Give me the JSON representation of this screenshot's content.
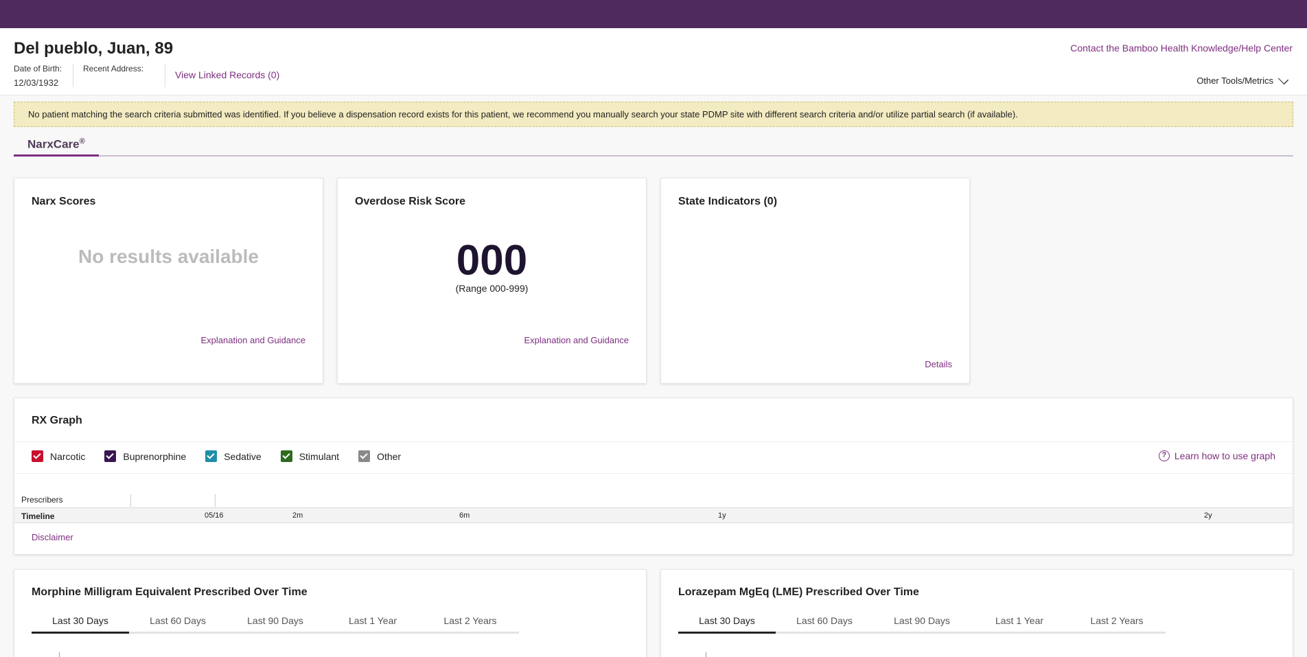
{
  "header": {
    "patient_name": "Del pueblo, Juan, 89",
    "dob_label": "Date of Birth:",
    "dob_value": "12/03/1932",
    "address_label": "Recent Address:",
    "address_value": "",
    "linked_records": "View Linked Records (0)",
    "help_link": "Contact the Bamboo Health Knowledge/Help Center",
    "other_tools": "Other Tools/Metrics"
  },
  "alert": {
    "message": "No patient matching the search criteria submitted was identified. If you believe a dispensation record exists for this patient, we recommend you manually search your state PDMP site with different search criteria and/or utilize partial search (if available)."
  },
  "tabs": {
    "narxcare": "NarxCare",
    "narxcare_mark": "®"
  },
  "cards": {
    "narx_scores": {
      "title": "Narx Scores",
      "empty_text": "No results available",
      "link": "Explanation and Guidance"
    },
    "overdose": {
      "title": "Overdose Risk Score",
      "score": "000",
      "range": "(Range 000-999)",
      "link": "Explanation and Guidance"
    },
    "state_indicators": {
      "title": "State Indicators (0)",
      "link": "Details"
    }
  },
  "rx_graph": {
    "title": "RX Graph",
    "legend": [
      {
        "label": "Narcotic",
        "color": "#c8102e"
      },
      {
        "label": "Buprenorphine",
        "color": "#3b1550"
      },
      {
        "label": "Sedative",
        "color": "#1f8fa8"
      },
      {
        "label": "Stimulant",
        "color": "#2e6b1f"
      },
      {
        "label": "Other",
        "color": "#8a8a8a"
      }
    ],
    "learn_link": "Learn how to use graph",
    "learn_icon": "question-circle-icon",
    "prescribers_label": "Prescribers",
    "timeline_label": "Timeline",
    "ticks": [
      "05/16",
      "2m",
      "6m",
      "1y",
      "2y"
    ],
    "disclaimer": "Disclaimer"
  },
  "mme_panel": {
    "title": "Morphine Milligram Equivalent Prescribed Over Time",
    "tabs": [
      "Last 30 Days",
      "Last 60 Days",
      "Last 90 Days",
      "Last 1 Year",
      "Last 2 Years"
    ],
    "active_tab": "Last 30 Days"
  },
  "lme_panel": {
    "title": "Lorazepam MgEq (LME) Prescribed Over Time",
    "tabs": [
      "Last 30 Days",
      "Last 60 Days",
      "Last 90 Days",
      "Last 1 Year",
      "Last 2 Years"
    ],
    "active_tab": "Last 30 Days"
  },
  "colors": {
    "topbar": "#4f2a5f",
    "accent_link": "#7d2e7f",
    "alert_bg": "#f3ebc1"
  }
}
